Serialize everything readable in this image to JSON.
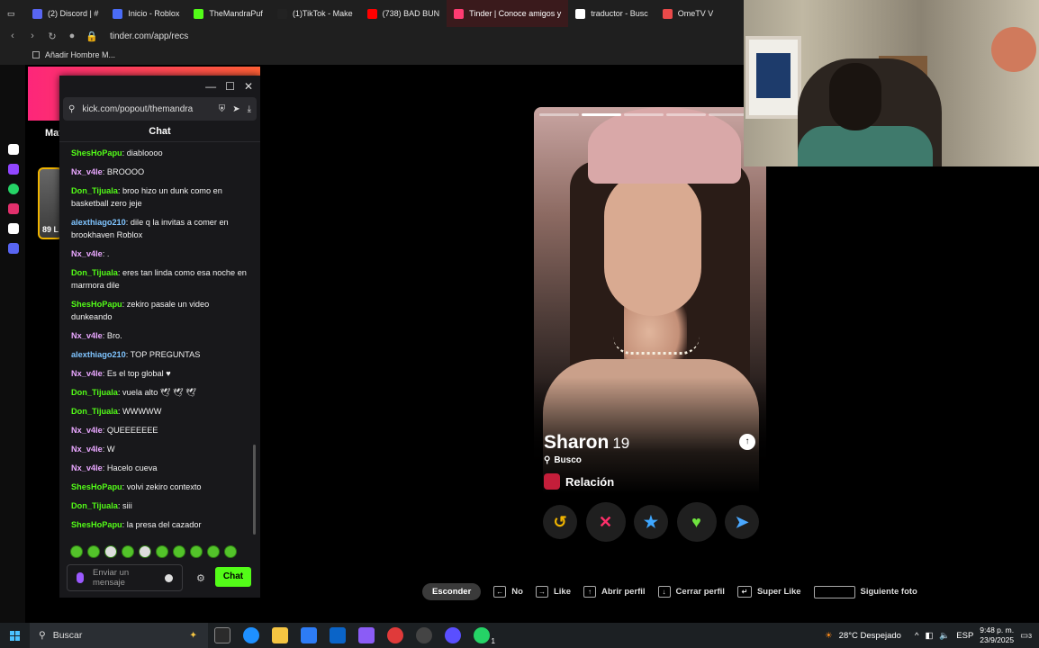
{
  "browser": {
    "tabs": [
      {
        "label": "(2) Discord | #",
        "color": "#5865f2"
      },
      {
        "label": "Inicio - Roblox",
        "color": "#4a6cf7"
      },
      {
        "label": "TheMandraPuf",
        "color": "#53fc18"
      },
      {
        "label": "(1)TikTok - Make",
        "color": "#222222"
      },
      {
        "label": "(738) BAD BUN",
        "color": "#ff0000"
      },
      {
        "label": "Tinder | Conoce amigos y",
        "color": "#fe3c72",
        "active": true
      },
      {
        "label": "traductor - Busc",
        "color": "#ffffff"
      },
      {
        "label": "OmeTV V",
        "color": "#e84a4a"
      }
    ],
    "url": "tinder.com/app/recs",
    "bookmark": "Añadir Hombre M..."
  },
  "tinder_bg": {
    "match_tab": "Mat",
    "card_count": "89 L"
  },
  "popup": {
    "url": "kick.com/popout/themandra",
    "title": "Chat",
    "messages": [
      {
        "user": "ShesHoPapu",
        "text": ": diabloooo",
        "color": "#53fc18"
      },
      {
        "user": "Nx_v4le",
        "text": ": BROOOO",
        "color": "#e9a7ff"
      },
      {
        "user": "Don_Tijuala",
        "text": ": broo hizo un dunk como en basketball zero jeje",
        "color": "#53fc18"
      },
      {
        "user": "alexthiago210",
        "text": ": dile q la invitas a comer en brookhaven Roblox",
        "color": "#7fc4ff"
      },
      {
        "user": "Nx_v4le",
        "text": ": .",
        "color": "#e9a7ff"
      },
      {
        "user": "Don_Tijuala",
        "text": ": eres tan linda como esa noche en marmora dile",
        "color": "#53fc18"
      },
      {
        "user": "ShesHoPapu",
        "text": ": zekiro pasale un video dunkeando",
        "color": "#53fc18"
      },
      {
        "user": "Nx_v4le",
        "text": ": Bro.",
        "color": "#e9a7ff"
      },
      {
        "user": "alexthiago210",
        "text": ": TOP PREGUNTAS",
        "color": "#7fc4ff"
      },
      {
        "user": "Nx_v4le",
        "text": ": Es el top global ♥",
        "color": "#e9a7ff"
      },
      {
        "user": "Don_Tijuala",
        "text": ": vuela alto 🕊 🕊 🕊",
        "color": "#53fc18"
      },
      {
        "user": "Don_Tijuala",
        "text": ": WWWWW",
        "color": "#53fc18"
      },
      {
        "user": "Nx_v4le",
        "text": ": QUEEEEEEE",
        "color": "#e9a7ff"
      },
      {
        "user": "Nx_v4le",
        "text": ": W",
        "color": "#e9a7ff"
      },
      {
        "user": "Nx_v4le",
        "text": ": Hacelo cueva",
        "color": "#e9a7ff"
      },
      {
        "user": "ShesHoPapu",
        "text": ": volvi zekiro contexto",
        "color": "#53fc18"
      },
      {
        "user": "Don_Tijuala",
        "text": ": siii",
        "color": "#53fc18"
      },
      {
        "user": "ShesHoPapu",
        "text": ": la presa del cazador",
        "color": "#53fc18"
      }
    ],
    "input_placeholder": "Enviar un mensaje",
    "send_label": "Chat"
  },
  "profile": {
    "name": "Sharon",
    "age": "19",
    "looking_label": "Busco",
    "looking_value": "Relación",
    "actions": [
      "rewind",
      "nope",
      "super-like",
      "like",
      "boost"
    ]
  },
  "hints": {
    "hide": "Esconder",
    "no": "No",
    "like": "Like",
    "open_profile": "Abrir perfil",
    "close_profile": "Cerrar perfil",
    "super_like": "Super Like",
    "next_photo": "Siguiente foto"
  },
  "taskbar": {
    "search": "Buscar",
    "weather": "28°C  Despejado",
    "lang": "ESP",
    "time": "9:48 p. m.",
    "date": "23/9/2025",
    "notif": "3",
    "whatsapp_badge": "1"
  }
}
